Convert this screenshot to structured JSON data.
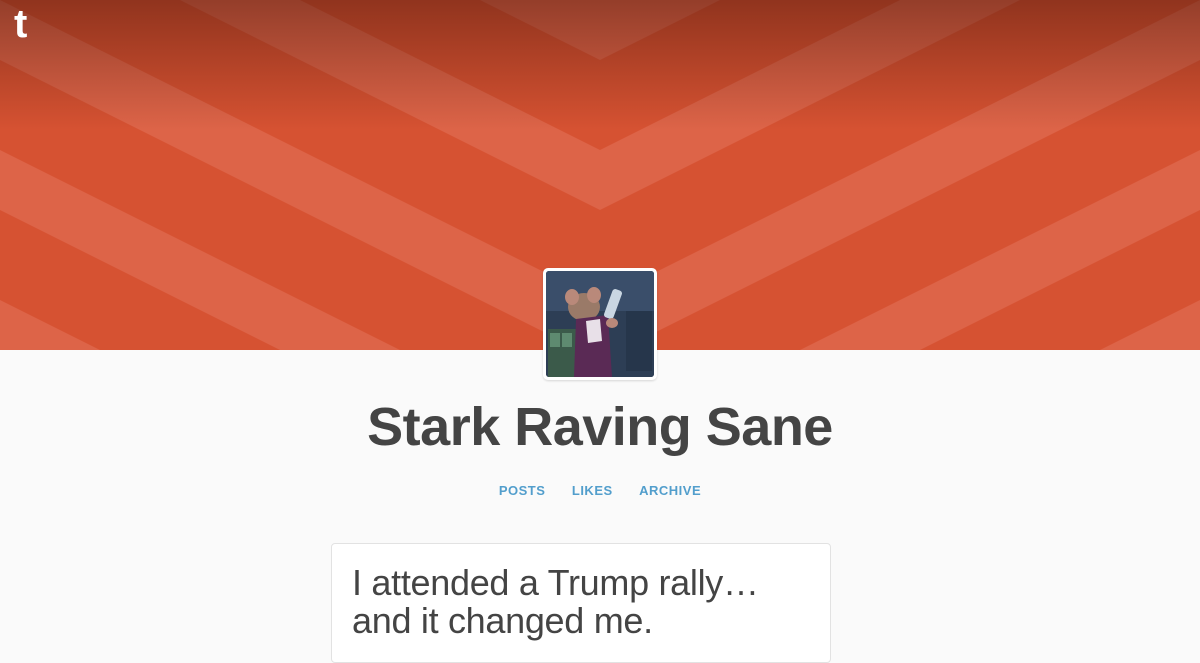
{
  "header": {
    "logo_glyph": "t",
    "colors": {
      "background": "#d65232",
      "stripe": "#dd6448",
      "shade": "#7a2a1a"
    }
  },
  "avatar": {
    "alt": "blog avatar"
  },
  "blog": {
    "title": "Stark Raving Sane"
  },
  "nav": {
    "items": [
      {
        "label": "POSTS"
      },
      {
        "label": "LIKES"
      },
      {
        "label": "ARCHIVE"
      }
    ],
    "color": "#529ecc"
  },
  "post": {
    "title": "I attended a Trump rally…and it changed me."
  }
}
